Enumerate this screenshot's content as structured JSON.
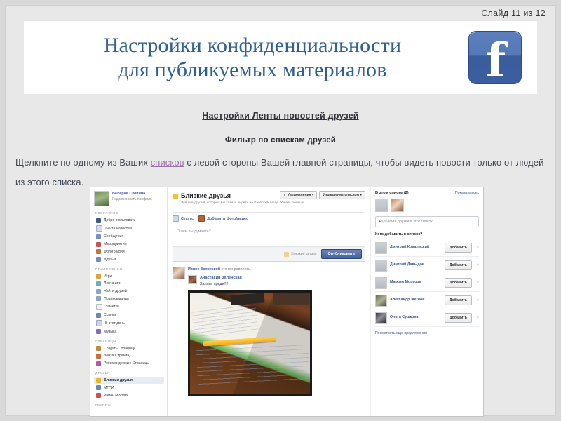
{
  "slide": {
    "number_text": "Слайд 11 из 12",
    "title_line1": "Настройки конфиденциальности",
    "title_line2": "для публикуемых материалов",
    "logo_glyph": "f",
    "title_color": "#2e6096",
    "link_color": "#9b6fb0",
    "sub_head": "Настройки Ленты новостей друзей",
    "sub_head2": "Фильтр по спискам друзей",
    "paragraph_before": "Щелкните по одному из Ваших ",
    "paragraph_link": "списков",
    "paragraph_after": " с левой стороны Вашей главной страницы, чтобы видеть новости только от людей из этого списка."
  },
  "screenshot": {
    "sidebar": {
      "profile": {
        "name": "Валерия Скопина",
        "edit_link": "Редактировать профиль"
      },
      "sections": [
        {
          "header": "ИЗБРАННОЕ",
          "items": [
            {
              "label": "Добро пожаловать",
              "icon": "facebook-icon"
            },
            {
              "label": "Лента новостей",
              "icon": "newsfeed-icon"
            },
            {
              "label": "Сообщения",
              "icon": "messages-icon"
            },
            {
              "label": "Мероприятия",
              "icon": "events-icon"
            },
            {
              "label": "Фотографии",
              "icon": "photos-icon"
            },
            {
              "label": "Друзья",
              "icon": "friends-icon"
            }
          ]
        },
        {
          "header": "ПРИЛОЖЕНИЯ",
          "items": [
            {
              "label": "Игры",
              "icon": "games-icon"
            },
            {
              "label": "Лента игр",
              "icon": "games-feed-icon"
            },
            {
              "label": "Найти друзей",
              "icon": "find-friends-icon"
            },
            {
              "label": "Подписывания",
              "icon": "subscriptions-icon"
            },
            {
              "label": "Заметки",
              "icon": "notes-icon"
            },
            {
              "label": "Ссылки",
              "icon": "links-icon"
            },
            {
              "label": "В этот день",
              "icon": "on-this-day-icon"
            },
            {
              "label": "Музыка",
              "icon": "music-icon"
            }
          ]
        },
        {
          "header": "СТРАНИЦЫ",
          "items": [
            {
              "label": "Создать Страницу ...",
              "icon": "create-page-icon"
            },
            {
              "label": "Лента Страниц",
              "icon": "pages-feed-icon"
            },
            {
              "label": "Рекомендуемые Страницы",
              "icon": "suggested-pages-icon"
            }
          ]
        },
        {
          "header": "ДРУЗЬЯ",
          "items": [
            {
              "label": "Близкие друзья",
              "icon": "star-icon",
              "selected": true
            },
            {
              "label": "МГПИ",
              "icon": "list-icon"
            },
            {
              "label": "Район Москва",
              "icon": "location-icon"
            }
          ]
        },
        {
          "header": "ГРУППЫ",
          "items": []
        }
      ]
    },
    "main": {
      "list_title": "Близкие друзья",
      "list_description": "Лучшие друзья, которых вы хотите видеть на Facebook чаще. Узнать больше",
      "buttons": [
        {
          "label": "Уведомления",
          "icon": "check-icon",
          "caret": "▾"
        },
        {
          "label": "Управление списком",
          "caret": "▾"
        }
      ],
      "composer": {
        "tab_status": "Статус",
        "tab_photo": "Добавить фото/видео",
        "placeholder": "О чем вы думаете?",
        "audience": "Близкие друзья",
        "post_button": "Опубликовать"
      },
      "feed": [
        {
          "like_name": "Ирине Золотовой",
          "like_text": " это понравилось.",
          "author": "Анастасия Зеленская",
          "text": "Халява приди!!!!",
          "has_photo": true
        }
      ]
    },
    "right": {
      "in_list_title": "В этом списке (2)",
      "show_all": "Показать всех",
      "add_friends_placeholder": "Добавьте друзей в этот список",
      "add_plus": "+",
      "who_to_add_title": "Кого добавить в список?",
      "suggestions": [
        {
          "name": "Дмитрий Ковальский",
          "button": "Добавить",
          "close": "×"
        },
        {
          "name": "Дмитрий Давыдов",
          "button": "Добавить",
          "close": "×"
        },
        {
          "name": "Максим Морозов",
          "button": "Добавить",
          "close": "×"
        },
        {
          "name": "Александр Жеглов",
          "button": "Добавить",
          "close": "×"
        },
        {
          "name": "Ольга Сушкова",
          "button": "Добавить",
          "close": "×"
        }
      ],
      "more_link": "Посмотреть еще предложения"
    }
  }
}
